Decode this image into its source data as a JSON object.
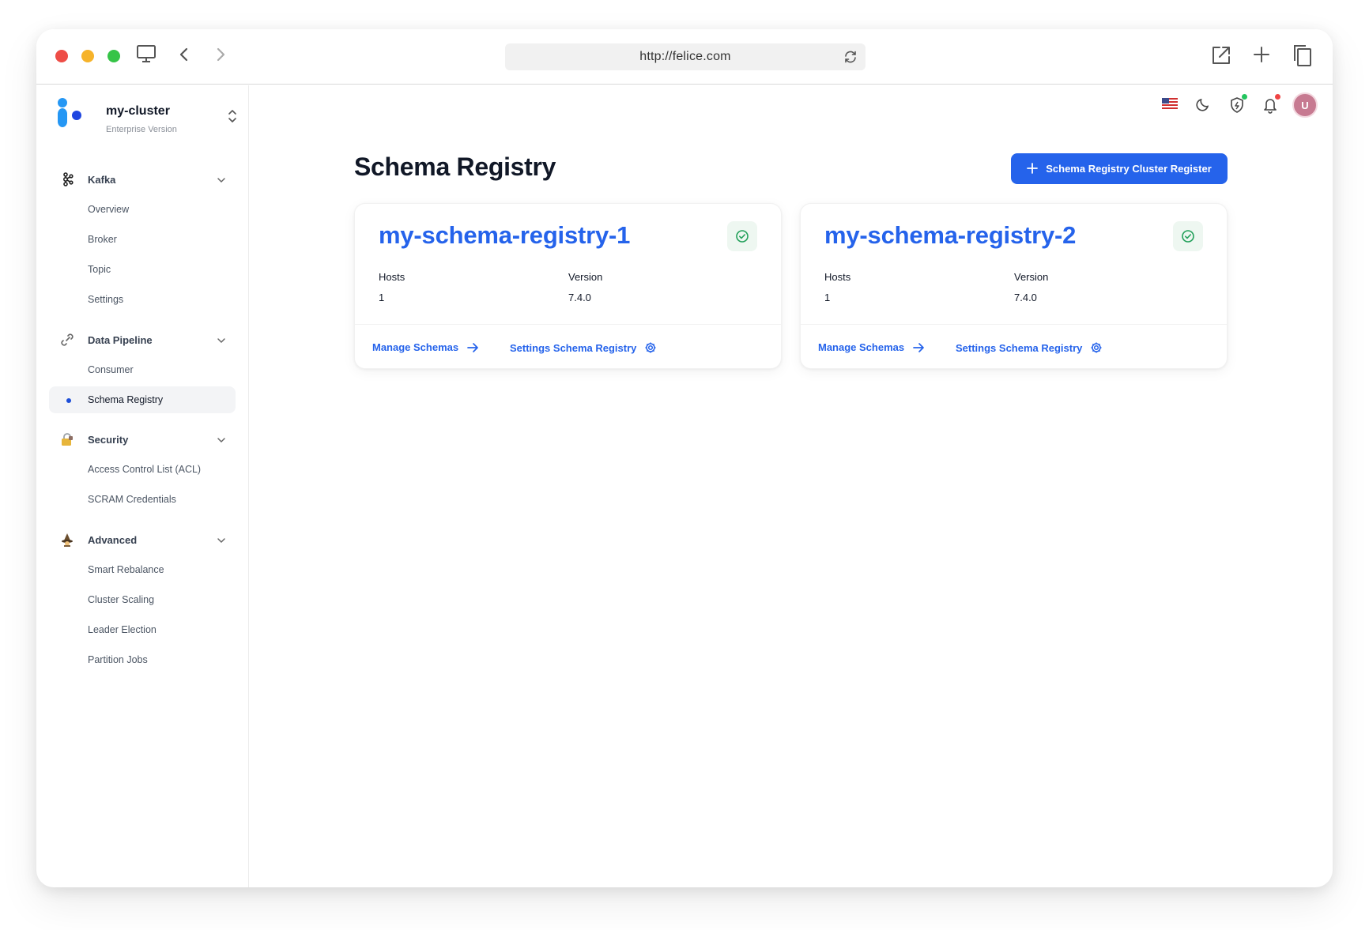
{
  "browser": {
    "url": "http://felice.com"
  },
  "brand": {
    "name": "my-cluster",
    "subtitle": "Enterprise Version"
  },
  "sidebar": {
    "sections": [
      {
        "label": "Kafka",
        "icon": "kafka-icon",
        "items": [
          "Overview",
          "Broker",
          "Topic",
          "Settings"
        ]
      },
      {
        "label": "Data Pipeline",
        "icon": "link-icon",
        "items": [
          "Consumer",
          "Schema Registry"
        ]
      },
      {
        "label": "Security",
        "icon": "lock-icon",
        "items": [
          "Access Control List (ACL)",
          "SCRAM Credentials"
        ]
      },
      {
        "label": "Advanced",
        "icon": "wizard-icon",
        "items": [
          "Smart Rebalance",
          "Cluster Scaling",
          "Leader Election",
          "Partition Jobs"
        ]
      }
    ],
    "active_item": "Schema Registry"
  },
  "header": {
    "avatar_initial": "U",
    "icons": [
      "us-flag-icon",
      "moon-icon",
      "shield-icon",
      "bell-icon"
    ]
  },
  "main": {
    "title": "Schema Registry",
    "register_button": "Schema Registry Cluster Register",
    "cards": [
      {
        "name": "my-schema-registry-1",
        "hosts_label": "Hosts",
        "hosts_value": "1",
        "version_label": "Version",
        "version_value": "7.4.0",
        "manage_link": "Manage Schemas",
        "settings_link": "Settings Schema Registry"
      },
      {
        "name": "my-schema-registry-2",
        "hosts_label": "Hosts",
        "hosts_value": "1",
        "version_label": "Version",
        "version_value": "7.4.0",
        "manage_link": "Manage Schemas",
        "settings_link": "Settings Schema Registry"
      }
    ]
  },
  "colors": {
    "accent": "#2563eb",
    "status_ok": "#22a05a",
    "notification_dot": "#ef4444",
    "shield_dot": "#22c55e"
  }
}
